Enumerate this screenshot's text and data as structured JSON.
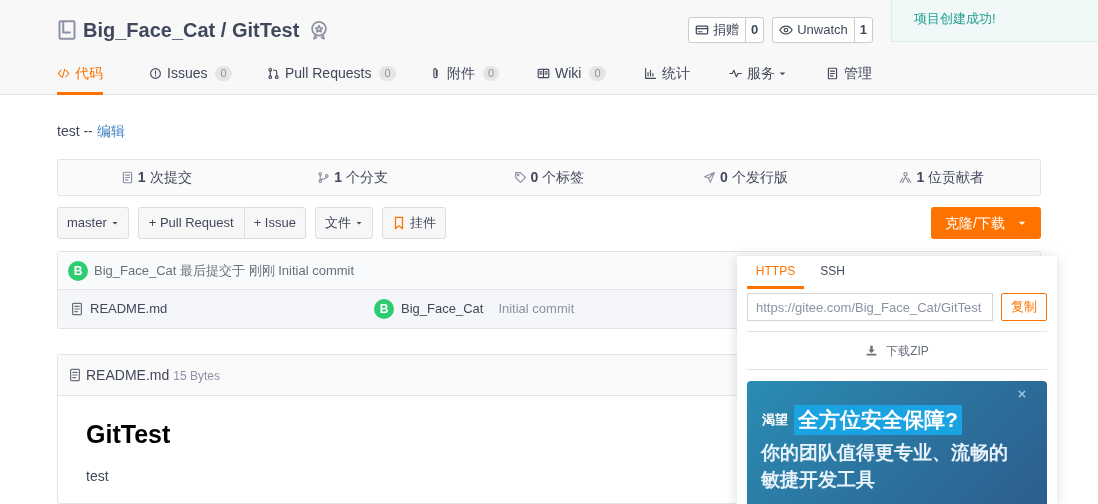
{
  "repo": {
    "owner": "Big_Face_Cat",
    "separator": "/",
    "name": "GitTest"
  },
  "header_buttons": [
    {
      "label": "捐赠",
      "count": "0"
    },
    {
      "label": "Unwatch",
      "count": "1"
    }
  ],
  "toast": "项目创建成功!",
  "tabs": [
    {
      "label": "代码",
      "dropdown": false,
      "selected": true
    },
    {
      "label": "Issues",
      "count": "0",
      "dropdown": false,
      "selected": false
    },
    {
      "label": "Pull Requests",
      "count": "0",
      "dropdown": false,
      "selected": false
    },
    {
      "label": "附件",
      "count": "0",
      "dropdown": false,
      "selected": false
    },
    {
      "label": "Wiki",
      "count": "0",
      "dropdown": false,
      "selected": false
    },
    {
      "label": "统计",
      "dropdown": false,
      "selected": false
    },
    {
      "label": "服务",
      "dropdown": true,
      "selected": false
    },
    {
      "label": "管理",
      "dropdown": false,
      "selected": false
    }
  ],
  "description": {
    "text": "test --",
    "link": "编辑"
  },
  "stats": [
    {
      "count": "1",
      "label": "次提交"
    },
    {
      "count": "1",
      "label": "个分支"
    },
    {
      "count": "0",
      "label": "个标签"
    },
    {
      "count": "0",
      "label": "个发行版"
    },
    {
      "count": "1",
      "label": "位贡献者"
    }
  ],
  "toolbar": {
    "branch": "master",
    "pull_request": "+ Pull Request",
    "issue": "+ Issue",
    "files": "文件",
    "widget": "挂件",
    "clone": "克隆/下载"
  },
  "last_commit": {
    "avatar": "B",
    "text": "Big_Face_Cat 最后提交于 刚刚 Initial commit"
  },
  "files": [
    {
      "name": "README.md",
      "avatar": "B",
      "author": "Big_Face_Cat",
      "message": "Initial commit"
    }
  ],
  "readme": {
    "file": "README.md",
    "size": "15 Bytes",
    "heading": "GitTest",
    "body": "test"
  },
  "clone_panel": {
    "tabs": [
      {
        "label": "HTTPS",
        "selected": true
      },
      {
        "label": "SSH",
        "selected": false
      }
    ],
    "url": "https://gitee.com/Big_Face_Cat/GitTest",
    "copy": "复制",
    "download": "下载ZIP",
    "banner": {
      "prefix": "渴望",
      "highlight": "全方位安全保障?",
      "line1": "你的团队值得更专业、流畅的",
      "line2": "敏捷开发工具"
    }
  }
}
